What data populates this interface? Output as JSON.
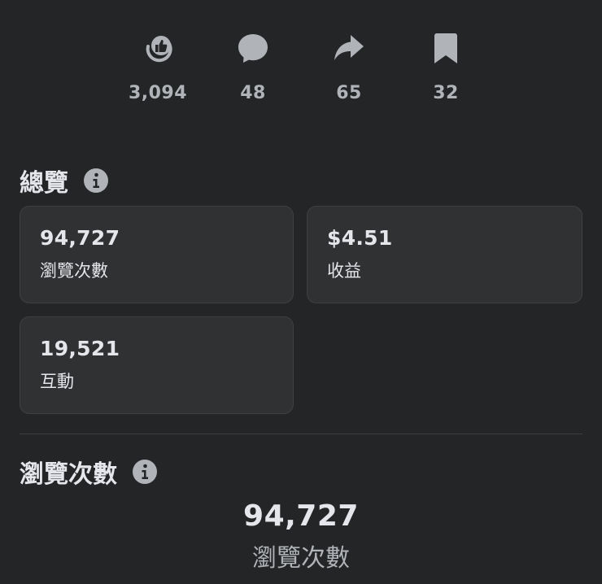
{
  "reactions": [
    {
      "icon": "like-icon",
      "count": "3,094"
    },
    {
      "icon": "comment-icon",
      "count": "48"
    },
    {
      "icon": "share-icon",
      "count": "65"
    },
    {
      "icon": "bookmark-icon",
      "count": "32"
    }
  ],
  "overview": {
    "title": "總覽",
    "cards": [
      {
        "value": "94,727",
        "label": "瀏覽次數"
      },
      {
        "value": "$4.51",
        "label": "收益"
      },
      {
        "value": "19,521",
        "label": "互動"
      }
    ]
  },
  "views": {
    "title": "瀏覽次數",
    "value": "94,727",
    "label": "瀏覽次數"
  },
  "colors": {
    "background": "#242526",
    "card": "#303133",
    "icon": "#b0b3b8",
    "text": "#e4e6eb"
  }
}
